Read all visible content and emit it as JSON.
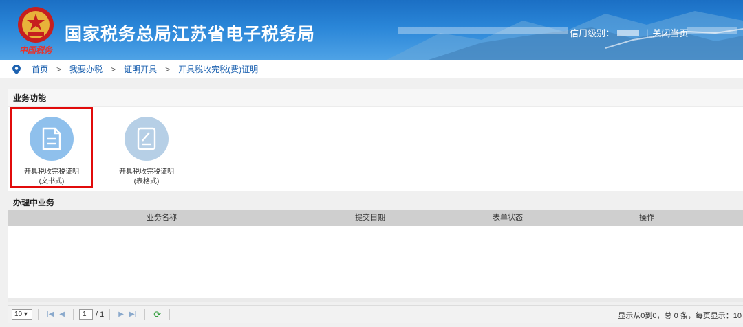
{
  "header": {
    "slogan": "中国税务",
    "title": "国家税务总局江苏省电子税务局",
    "credit_label": "信用级别：",
    "sep": "|",
    "close_label": "关闭当页"
  },
  "breadcrumb": {
    "items": [
      "首页",
      "我要办税",
      "证明开具",
      "开具税收完税(费)证明"
    ],
    "sep": ">"
  },
  "functions": {
    "title": "业务功能",
    "items": [
      {
        "line1": "开具税收完税证明",
        "line2": "(文书式)"
      },
      {
        "line1": "开具税收完税证明",
        "line2": "(表格式)"
      }
    ]
  },
  "in_progress": {
    "title": "办理中业务",
    "columns": [
      "业务名称",
      "提交日期",
      "表单状态",
      "操作"
    ]
  },
  "pager": {
    "page_size": "10",
    "page_input": "1",
    "page_total": "/ 1",
    "info": "显示从0到0，总 0 条，每页显示：10"
  },
  "colors": {
    "header_blue": "#2a86d8",
    "link_blue": "#1d62b0",
    "highlight_red": "#e10b0b",
    "icon_blue": "#8fc0ec"
  }
}
